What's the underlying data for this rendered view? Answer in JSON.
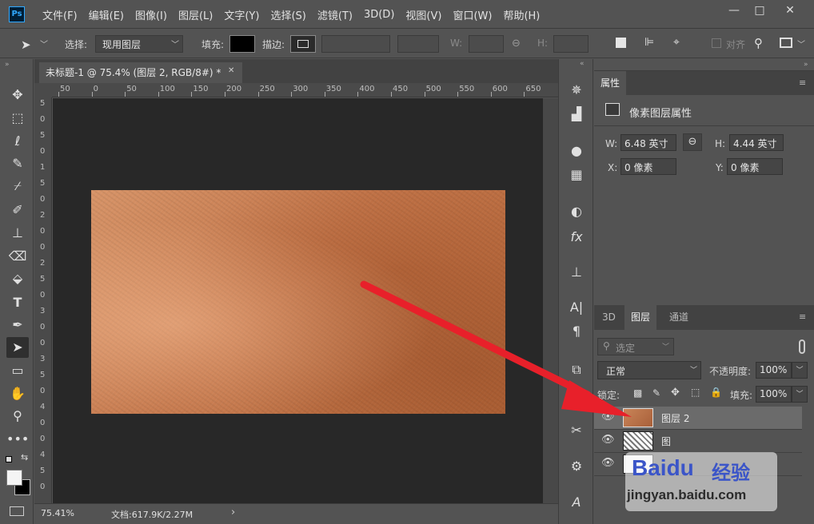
{
  "app": {
    "logo": "Ps"
  },
  "menu": [
    "文件(F)",
    "编辑(E)",
    "图像(I)",
    "图层(L)",
    "文字(Y)",
    "选择(S)",
    "滤镜(T)",
    "3D(D)",
    "视图(V)",
    "窗口(W)",
    "帮助(H)"
  ],
  "window_controls": {
    "minimize": "—",
    "restore": "□",
    "close": "✕"
  },
  "options": {
    "select_label": "选择:",
    "select_value": "现用图层",
    "fill_label": "填充:",
    "stroke_label": "描边:",
    "w_label": "W:",
    "h_label": "H:",
    "align_label": "对齐"
  },
  "document": {
    "tab_title": "未标题-1 @ 75.4% (图层 2, RGB/8#) *",
    "tab_close": "✕",
    "ruler_top": [
      "50",
      "0",
      "50",
      "100",
      "150",
      "200",
      "250",
      "300",
      "350",
      "400",
      "450",
      "500",
      "550",
      "600",
      "650"
    ],
    "ruler_left": [
      "5",
      "0",
      "5",
      "0",
      "1",
      "5",
      "0",
      "2",
      "0",
      "0",
      "2",
      "5",
      "0",
      "3",
      "0",
      "0",
      "3",
      "5",
      "0",
      "4",
      "0",
      "0",
      "4",
      "5",
      "0"
    ]
  },
  "status": {
    "zoom": "75.41%",
    "doc_info": "文档:617.9K/2.27M",
    "arrow": "›"
  },
  "properties": {
    "tab": "属性",
    "heading": "像素图层属性",
    "w_label": "W:",
    "w_value": "6.48 英寸",
    "h_label": "H:",
    "h_value": "4.44 英寸",
    "x_label": "X:",
    "x_value": "0 像素",
    "y_label": "Y:",
    "y_value": "0 像素"
  },
  "layers_panel": {
    "tabs": [
      "3D",
      "图层",
      "通道"
    ],
    "filter_placeholder": "选定",
    "blend_mode": "正常",
    "opacity_label": "不透明度:",
    "opacity_value": "100%",
    "lock_label": "锁定:",
    "fill_label": "填充:",
    "fill_value": "100%",
    "layers": [
      {
        "name": "图层 2",
        "selected": true,
        "thumb": "leather"
      },
      {
        "name": "图",
        "selected": false,
        "thumb": "texture"
      },
      {
        "name": "",
        "selected": false,
        "thumb": "white"
      }
    ]
  },
  "watermark": {
    "brand": "Baidu",
    "brand_cn": "经验",
    "url": "jingyan.baidu.com"
  },
  "colors": {
    "accent": "#31a8ff",
    "arrow": "#e8202a"
  }
}
